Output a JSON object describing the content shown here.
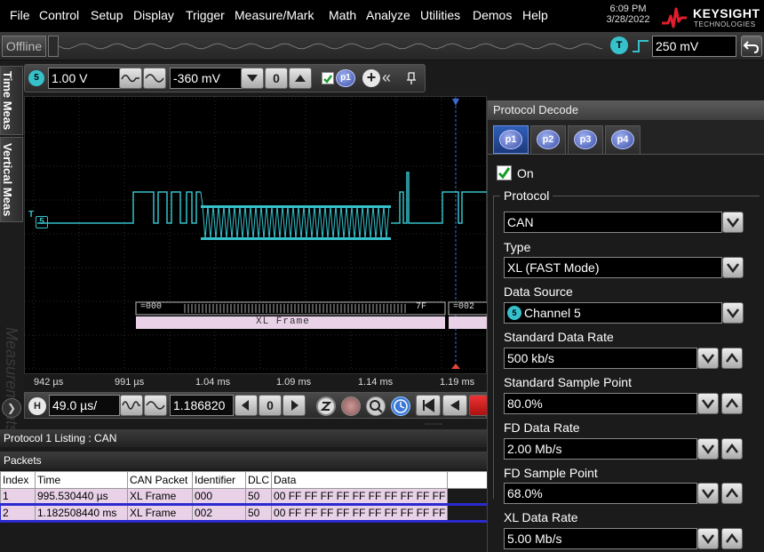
{
  "menu": {
    "items": [
      "File",
      "Control",
      "Setup",
      "Display",
      "Trigger",
      "Measure/Mark",
      "Math",
      "Analyze",
      "Utilities",
      "Demos",
      "Help"
    ],
    "time": "6:09 PM",
    "date": "3/28/2022",
    "brand_name": "KEYSIGHT",
    "brand_sub": "TECHNOLOGIES"
  },
  "status": {
    "offline_label": "Offline",
    "trigger_source": "T",
    "trigger_level": "250 mV"
  },
  "sidetabs": {
    "time_meas": "Time Meas",
    "vertical_meas": "Vertical Meas",
    "measurements_ghost": "Measurements"
  },
  "vertical": {
    "channel": "5",
    "scale": "1.00 V",
    "offset": "-360 mV",
    "zero_label": "0",
    "protocol_badge": "p1"
  },
  "scope": {
    "trigger_marker": "T",
    "channel_marker": "5",
    "bus_segment_1": "=000",
    "bus_segment_2": "7F",
    "bus_segment_3": "=002",
    "frame_label": "XL Frame",
    "time_ticks": [
      "942 µs",
      "991 µs",
      "1.04 ms",
      "1.09 ms",
      "1.14 ms",
      "1.19 ms"
    ]
  },
  "horizontal": {
    "label": "H",
    "scale": "49.0 µs/",
    "position": "1.186820",
    "zero_label": "0"
  },
  "listing": {
    "title": "Protocol 1 Listing : CAN",
    "packets_label": "Packets",
    "columns": [
      "Index",
      "Time",
      "CAN Packet",
      "Identifier",
      "DLC",
      "Data"
    ],
    "rows": [
      {
        "index": "1",
        "time": "995.530440 µs",
        "packet": "XL Frame",
        "identifier": "000",
        "dlc": "50",
        "data": "00 FF FF FF FF FF FF FF FF FF FF"
      },
      {
        "index": "2",
        "time": "1.182508440 ms",
        "packet": "XL Frame",
        "identifier": "002",
        "dlc": "50",
        "data": "00 FF FF FF FF FF FF FF FF FF FF"
      }
    ]
  },
  "decode": {
    "title": "Protocol Decode",
    "tabs": [
      "p1",
      "p2",
      "p3",
      "p4"
    ],
    "on_label": "On",
    "protocol_group": "Protocol",
    "protocol_value": "CAN",
    "type_label": "Type",
    "type_value": "XL (FAST Mode)",
    "source_label": "Data Source",
    "source_channel": "5",
    "source_value": "Channel 5",
    "std_rate_label": "Standard Data Rate",
    "std_rate_value": "500 kb/s",
    "std_sample_label": "Standard Sample Point",
    "std_sample_value": "80.0%",
    "fd_rate_label": "FD Data Rate",
    "fd_rate_value": "2.00 Mb/s",
    "fd_sample_label": "FD Sample Point",
    "fd_sample_value": "68.0%",
    "xl_rate_label": "XL Data Rate",
    "xl_rate_value": "5.00 Mb/s"
  },
  "colors": {
    "trace": "#36c1cb",
    "accent_blue": "#3a4fa8",
    "bus_fill": "#e9d2e8"
  }
}
